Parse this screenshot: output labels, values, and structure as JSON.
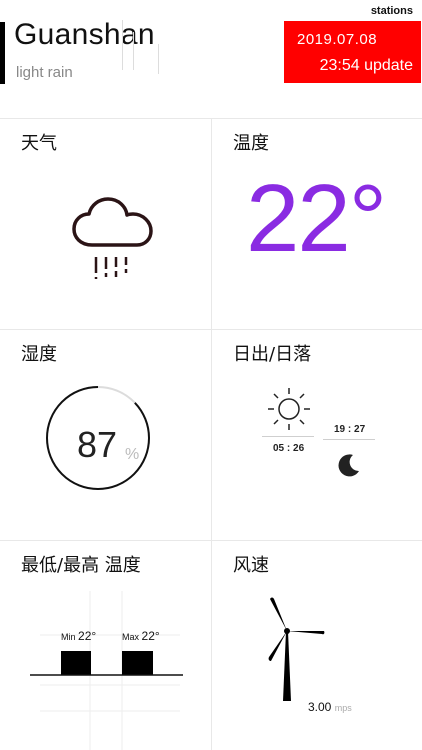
{
  "header": {
    "city": "Guanshan",
    "condition": "light rain",
    "stations_label": "stations",
    "update_date": "2019.07.08",
    "update_time": "23:54 update",
    "accent_color": "#ff0000"
  },
  "weather_card": {
    "title": "天气",
    "icon": "cloud-rain-icon"
  },
  "temperature_card": {
    "title": "温度",
    "value": "22°",
    "color": "#8a2be2"
  },
  "humidity_card": {
    "title": "湿度",
    "value": "87",
    "unit": "%",
    "percent": 87
  },
  "sun_card": {
    "title": "日出/日落",
    "sunrise": "05 : 26",
    "sunset": "19 : 27",
    "sun_icon": "sun-icon",
    "moon_icon": "moon-icon"
  },
  "minmax_card": {
    "title": "最低/最高 温度",
    "min_label": "Min",
    "min_value": "22°",
    "max_label": "Max",
    "max_value": "22°"
  },
  "wind_card": {
    "title": "风速",
    "value": "3.00",
    "unit": "mps",
    "icon": "wind-turbine-icon"
  }
}
